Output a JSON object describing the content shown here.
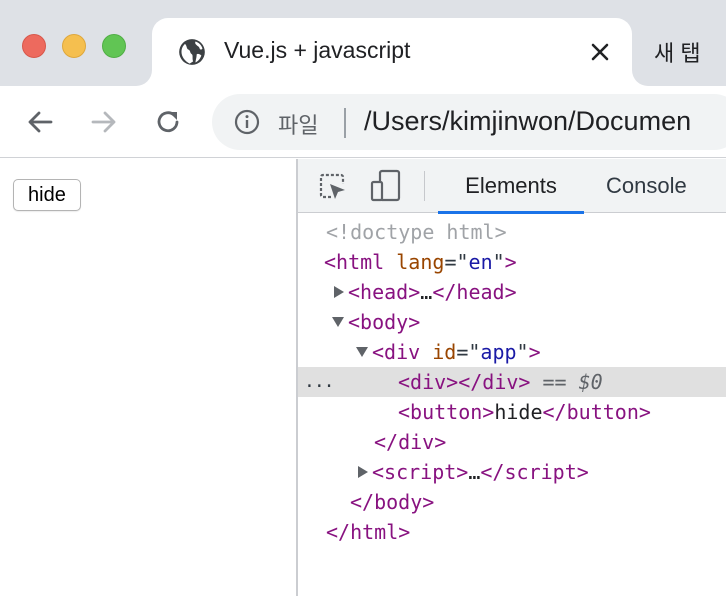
{
  "browser": {
    "active_tab": {
      "title": "Vue.js + javascript",
      "favicon": "globe-icon",
      "close": "close-icon"
    },
    "inactive_tab": {
      "title": "새 탭"
    },
    "toolbar": {
      "back": "arrow-left-icon",
      "forward": "arrow-right-icon",
      "reload": "reload-icon",
      "info": "info-icon",
      "file_label": "파일",
      "url": "/Users/kimjinwon/Documen"
    },
    "colors": {
      "tabstrip": "#dee1e6",
      "omnibox": "#f1f3f4",
      "accent": "#1a73e8"
    }
  },
  "page": {
    "hide_button": "hide"
  },
  "devtools": {
    "tabs": [
      {
        "label": "Elements"
      },
      {
        "label": "Console"
      }
    ],
    "dom": {
      "doctype": "<!doctype html>",
      "html_tag": "html",
      "lang_attr": "lang",
      "lang_val": "en",
      "head_tag": "head",
      "body_tag": "body",
      "div_tag": "div",
      "id_attr": "id",
      "id_val": "app",
      "button_tag": "button",
      "button_text": "hide",
      "script_tag": "script",
      "ellipsis": "…",
      "selected_marker": "== $0",
      "dots": "..."
    }
  }
}
